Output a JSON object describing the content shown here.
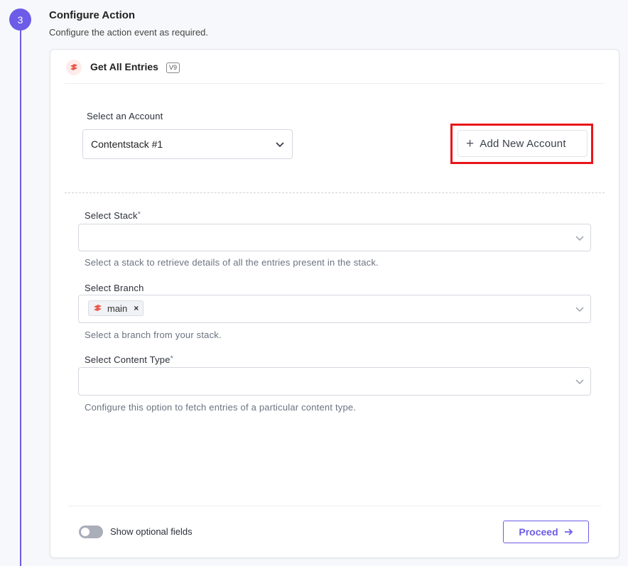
{
  "step": {
    "number": "3",
    "title": "Configure Action",
    "subtitle": "Configure the action event as required."
  },
  "header": {
    "title": "Get All Entries",
    "version": "V9",
    "logo_icon": "contentstack-logo-icon"
  },
  "account": {
    "label": "Select an Account",
    "value": "Contentstack #1",
    "add_button_label": "Add New Account",
    "highlight_color": "#e8161b"
  },
  "stack": {
    "label": "Select Stack",
    "required_mark": "*",
    "value": "",
    "help": "Select a stack to retrieve details of all the entries present in the stack."
  },
  "branch": {
    "label": "Select Branch",
    "tag": "main",
    "help": "Select a branch from your stack."
  },
  "content_type": {
    "label": "Select Content Type",
    "required_mark": "*",
    "value": "",
    "help": "Configure this option to fetch entries of a particular content type."
  },
  "footer": {
    "toggle_label": "Show optional fields",
    "toggle_on": false,
    "proceed_label": "Proceed"
  },
  "colors": {
    "accent": "#6c5ce7",
    "brand": "#e8594a"
  }
}
